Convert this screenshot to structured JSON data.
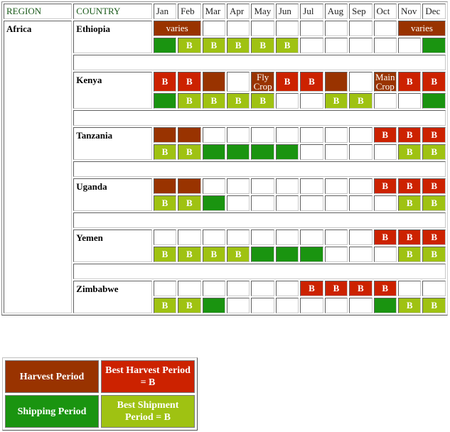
{
  "header": {
    "region": "REGION",
    "country": "COUNTRY",
    "months": [
      "Jan",
      "Feb",
      "Mar",
      "Apr",
      "May",
      "Jun",
      "Jul",
      "Aug",
      "Sep",
      "Oct",
      "Nov",
      "Dec"
    ]
  },
  "region": "Africa",
  "countries": [
    {
      "name": "Ethiopia",
      "harvest": [
        {
          "type": "harvest",
          "text": "varies",
          "span": 2
        },
        {
          "type": "empty"
        },
        {
          "type": "empty"
        },
        {
          "type": "empty"
        },
        {
          "type": "empty"
        },
        {
          "type": "empty"
        },
        {
          "type": "empty"
        },
        {
          "type": "empty"
        },
        {
          "type": "empty"
        },
        {
          "type": "harvest",
          "text": "varies",
          "span": 2
        }
      ],
      "shipping": [
        "ship",
        "best-ship",
        "best-ship",
        "best-ship",
        "best-ship",
        "best-ship",
        "empty",
        "empty",
        "empty",
        "empty",
        "empty",
        "ship"
      ]
    },
    {
      "name": "Kenya",
      "harvest": [
        {
          "type": "best-harvest",
          "text": "B"
        },
        {
          "type": "best-harvest",
          "text": "B"
        },
        {
          "type": "harvest"
        },
        {
          "type": "empty"
        },
        {
          "type": "harvest",
          "text": "Fly Crop",
          "note": true
        },
        {
          "type": "best-harvest",
          "text": "B"
        },
        {
          "type": "best-harvest",
          "text": "B"
        },
        {
          "type": "harvest"
        },
        {
          "type": "empty"
        },
        {
          "type": "harvest",
          "text": "Main Crop",
          "note": true
        },
        {
          "type": "best-harvest",
          "text": "B"
        },
        {
          "type": "best-harvest",
          "text": "B"
        }
      ],
      "shipping": [
        "ship",
        "best-ship",
        "best-ship",
        "best-ship",
        "best-ship",
        "empty",
        "empty",
        "best-ship",
        "best-ship",
        "empty",
        "empty",
        "ship"
      ]
    },
    {
      "name": "Tanzania",
      "harvest": [
        {
          "type": "harvest"
        },
        {
          "type": "harvest"
        },
        {
          "type": "empty"
        },
        {
          "type": "empty"
        },
        {
          "type": "empty"
        },
        {
          "type": "empty"
        },
        {
          "type": "empty"
        },
        {
          "type": "empty"
        },
        {
          "type": "empty"
        },
        {
          "type": "best-harvest",
          "text": "B"
        },
        {
          "type": "best-harvest",
          "text": "B"
        },
        {
          "type": "best-harvest",
          "text": "B"
        }
      ],
      "shipping": [
        "best-ship",
        "best-ship",
        "ship",
        "ship",
        "ship",
        "ship",
        "empty",
        "empty",
        "empty",
        "empty",
        "best-ship",
        "best-ship"
      ]
    },
    {
      "name": "Uganda",
      "harvest": [
        {
          "type": "harvest"
        },
        {
          "type": "harvest"
        },
        {
          "type": "empty"
        },
        {
          "type": "empty"
        },
        {
          "type": "empty"
        },
        {
          "type": "empty"
        },
        {
          "type": "empty"
        },
        {
          "type": "empty"
        },
        {
          "type": "empty"
        },
        {
          "type": "best-harvest",
          "text": "B"
        },
        {
          "type": "best-harvest",
          "text": "B"
        },
        {
          "type": "best-harvest",
          "text": "B"
        }
      ],
      "shipping": [
        "best-ship",
        "best-ship",
        "ship",
        "empty",
        "empty",
        "empty",
        "empty",
        "empty",
        "empty",
        "empty",
        "best-ship",
        "best-ship"
      ]
    },
    {
      "name": "Yemen",
      "harvest": [
        {
          "type": "empty"
        },
        {
          "type": "empty"
        },
        {
          "type": "empty"
        },
        {
          "type": "empty"
        },
        {
          "type": "empty"
        },
        {
          "type": "empty"
        },
        {
          "type": "empty"
        },
        {
          "type": "empty"
        },
        {
          "type": "empty"
        },
        {
          "type": "best-harvest",
          "text": "B"
        },
        {
          "type": "best-harvest",
          "text": "B"
        },
        {
          "type": "best-harvest",
          "text": "B"
        }
      ],
      "shipping": [
        "best-ship",
        "best-ship",
        "best-ship",
        "best-ship",
        "ship",
        "ship",
        "ship",
        "empty",
        "empty",
        "empty",
        "best-ship",
        "best-ship"
      ]
    },
    {
      "name": "Zimbabwe",
      "harvest": [
        {
          "type": "empty"
        },
        {
          "type": "empty"
        },
        {
          "type": "empty"
        },
        {
          "type": "empty"
        },
        {
          "type": "empty"
        },
        {
          "type": "empty"
        },
        {
          "type": "best-harvest",
          "text": "B"
        },
        {
          "type": "best-harvest",
          "text": "B"
        },
        {
          "type": "best-harvest",
          "text": "B"
        },
        {
          "type": "best-harvest",
          "text": "B"
        },
        {
          "type": "empty"
        },
        {
          "type": "empty"
        }
      ],
      "shipping": [
        "best-ship",
        "best-ship",
        "ship",
        "empty",
        "empty",
        "empty",
        "empty",
        "empty",
        "empty",
        "ship",
        "best-ship",
        "best-ship"
      ]
    }
  ],
  "best_marker": "B",
  "legend": [
    [
      {
        "type": "harvest",
        "label": "Harvest Period"
      },
      {
        "type": "best-harvest",
        "label": "Best Harvest Period = B"
      }
    ],
    [
      {
        "type": "ship",
        "label": "Shipping Period"
      },
      {
        "type": "best-ship",
        "label": "Best Shipment Period = B"
      }
    ]
  ],
  "colors": {
    "harvest": "#993300",
    "best_harvest": "#cc2200",
    "shipping": "#1a9410",
    "best_shipment": "#9fc212"
  }
}
